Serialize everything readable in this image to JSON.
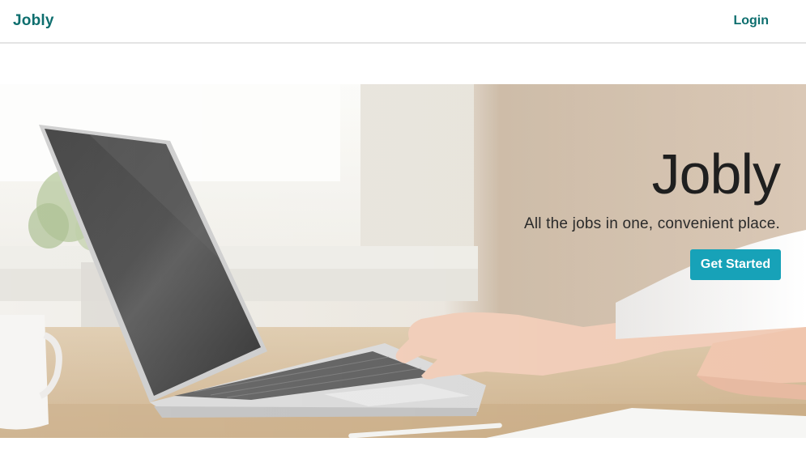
{
  "navbar": {
    "brand": "Jobly",
    "login_label": "Login"
  },
  "hero": {
    "title": "Jobly",
    "subtitle": "All the jobs in one, convenient place.",
    "cta_label": "Get Started",
    "image_subject": "person typing on a laptop at a desk"
  },
  "colors": {
    "brand": "#0d6e6e",
    "cta": "#17a2b8",
    "navbar_border": "#e4e4e4"
  }
}
